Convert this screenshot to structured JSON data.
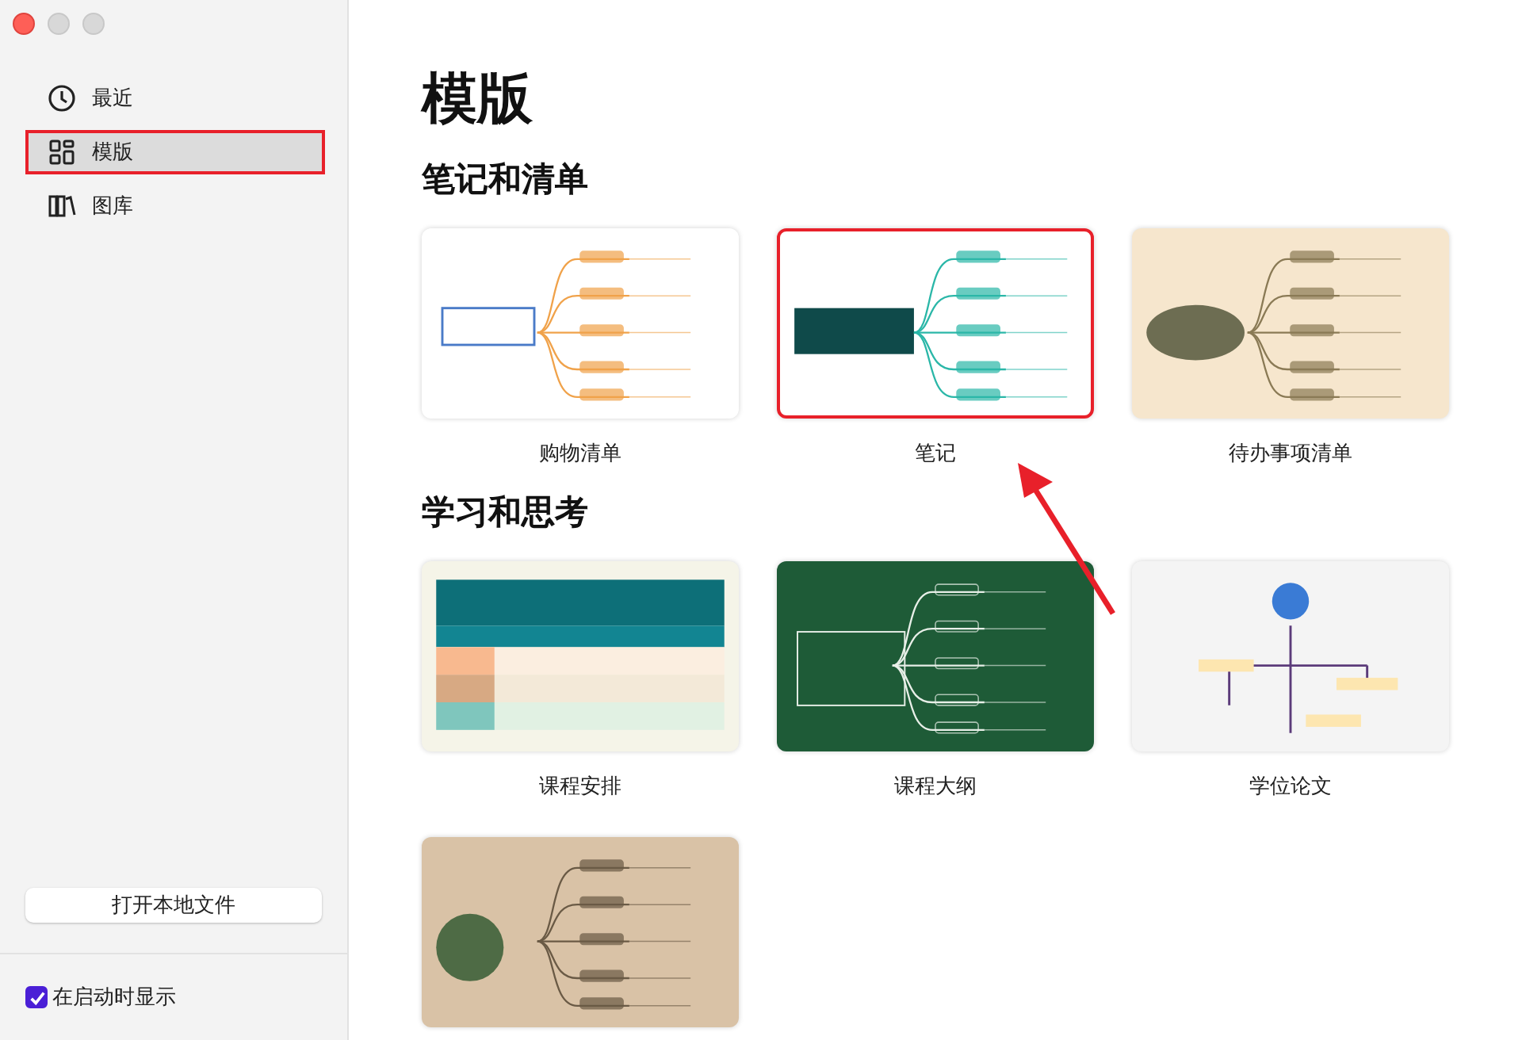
{
  "sidebar": {
    "items": [
      {
        "label": "最近",
        "kind": "clock",
        "selected": false,
        "highlighted": false
      },
      {
        "label": "模版",
        "kind": "grid",
        "selected": true,
        "highlighted": true
      },
      {
        "label": "图库",
        "kind": "books",
        "selected": false,
        "highlighted": false
      }
    ],
    "open_button": "打开本地文件",
    "startup_checkbox": {
      "label": "在启动时显示",
      "checked": true
    }
  },
  "page_title": "模版",
  "sections": [
    {
      "title": "笔记和清单",
      "templates": [
        {
          "name": "购物清单",
          "kind": "light",
          "highlighted": false
        },
        {
          "name": "笔记",
          "kind": "notes",
          "highlighted": true
        },
        {
          "name": "待办事项清单",
          "kind": "todo",
          "highlighted": false
        }
      ]
    },
    {
      "title": "学习和思考",
      "templates": [
        {
          "name": "课程安排",
          "kind": "schedule",
          "highlighted": false
        },
        {
          "name": "课程大纲",
          "kind": "chalk",
          "highlighted": false
        },
        {
          "name": "学位论文",
          "kind": "thesis",
          "highlighted": false
        },
        {
          "kind": "kraft",
          "highlighted": false
        }
      ]
    }
  ]
}
